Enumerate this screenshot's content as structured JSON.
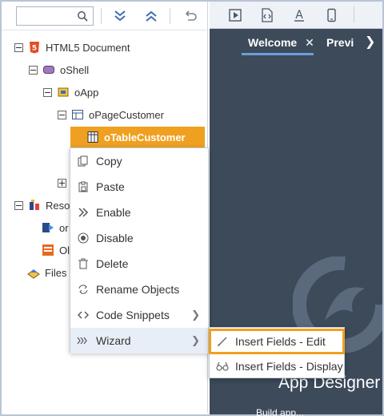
{
  "toolbar": {
    "search_value": ""
  },
  "tree": {
    "html5_document": "HTML5 Document",
    "oshell": "oShell",
    "oapp": "oApp",
    "opagecustomer": "oPageCustomer",
    "otablecustomer": "oTableCustomer",
    "reso": "Reso",
    "or": "or",
    "oi": "Ol",
    "files": "Files"
  },
  "context_menu": [
    {
      "label": "Copy",
      "icon": "copy-icon"
    },
    {
      "label": "Paste",
      "icon": "paste-icon"
    },
    {
      "label": "Enable",
      "icon": "enable-icon"
    },
    {
      "label": "Disable",
      "icon": "disable-icon"
    },
    {
      "label": "Delete",
      "icon": "delete-icon"
    },
    {
      "label": "Rename Objects",
      "icon": "rename-icon"
    },
    {
      "label": "Code Snippets",
      "icon": "code-icon",
      "has_submenu": true
    },
    {
      "label": "Wizard",
      "icon": "wizard-icon",
      "has_submenu": true
    }
  ],
  "submenu": [
    {
      "label": "Insert Fields - Edit",
      "icon": "pencil-icon"
    },
    {
      "label": "Insert Fields - Display",
      "icon": "glasses-icon"
    }
  ],
  "tabs": [
    {
      "label": "Welcome"
    },
    {
      "label": "Previ"
    }
  ],
  "welcome": {
    "brand": "App Designer",
    "subtitle": "Build app..."
  },
  "colors": {
    "accent": "#f0a020",
    "panel": "#3c4a5a",
    "tab_underline": "#6aa0d8"
  }
}
